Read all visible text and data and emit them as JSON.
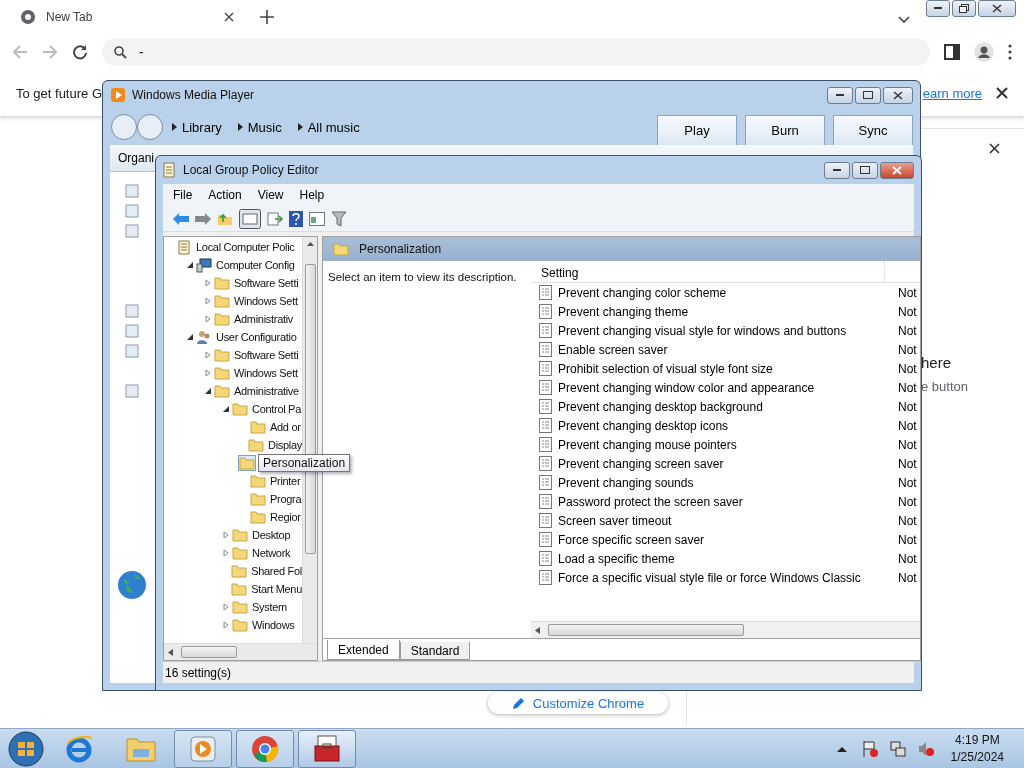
{
  "browser": {
    "tab_title": "New Tab",
    "address": "-",
    "infobar_text": "To get future G",
    "infobar_link": "earn more",
    "side_heading": "here",
    "side_text": "e button",
    "customize_button": "Customize Chrome"
  },
  "media_player": {
    "title": "Windows Media Player",
    "breadcrumb": [
      "Library",
      "Music",
      "All music"
    ],
    "tabs": [
      "Play",
      "Burn",
      "Sync"
    ],
    "organize": "Organi"
  },
  "policy_editor": {
    "title": "Local Group Policy Editor",
    "menu": [
      "File",
      "Action",
      "View",
      "Help"
    ],
    "tree": [
      {
        "label": "Local Computer Polic",
        "kind": "root",
        "children": [
          {
            "label": "Computer Config",
            "kind": "computer",
            "expanded": true,
            "children": [
              {
                "label": "Software Setti",
                "kind": "folder",
                "expanded": false
              },
              {
                "label": "Windows Sett",
                "kind": "folder",
                "expanded": false
              },
              {
                "label": "Administrativ",
                "kind": "folder",
                "expanded": false
              }
            ]
          },
          {
            "label": "User Configuratio",
            "kind": "user",
            "expanded": true,
            "children": [
              {
                "label": "Software Setti",
                "kind": "folder",
                "expanded": false
              },
              {
                "label": "Windows Sett",
                "kind": "folder",
                "expanded": false
              },
              {
                "label": "Administrative",
                "kind": "folder",
                "expanded": true,
                "children": [
                  {
                    "label": "Control Pa",
                    "kind": "folder",
                    "expanded": true,
                    "children": [
                      {
                        "label": "Add or",
                        "kind": "folder"
                      },
                      {
                        "label": "Display",
                        "kind": "folder"
                      },
                      {
                        "tooltip": "Personalization",
                        "kind": "folder",
                        "selected": true
                      },
                      {
                        "label": "Printer",
                        "kind": "folder"
                      },
                      {
                        "label": "Progra",
                        "kind": "folder"
                      },
                      {
                        "label": "Regior",
                        "kind": "folder"
                      }
                    ]
                  },
                  {
                    "label": "Desktop",
                    "kind": "folder",
                    "expanded": false
                  },
                  {
                    "label": "Network",
                    "kind": "folder",
                    "expanded": false
                  },
                  {
                    "label": "Shared Fol",
                    "kind": "folder"
                  },
                  {
                    "label": "Start Menu",
                    "kind": "folder"
                  },
                  {
                    "label": "System",
                    "kind": "folder",
                    "expanded": false
                  },
                  {
                    "label": "Windows",
                    "kind": "folder",
                    "expanded": false
                  }
                ]
              }
            ]
          }
        ]
      }
    ],
    "header": "Personalization",
    "description": "Select an item to view its description.",
    "column": "Setting",
    "rows": [
      {
        "name": "Prevent changing color scheme",
        "state": "Not"
      },
      {
        "name": "Prevent changing theme",
        "state": "Not"
      },
      {
        "name": "Prevent changing visual style for windows and buttons",
        "state": "Not"
      },
      {
        "name": "Enable screen saver",
        "state": "Not"
      },
      {
        "name": "Prohibit selection of visual style font size",
        "state": "Not"
      },
      {
        "name": "Prevent changing window color and appearance",
        "state": "Not"
      },
      {
        "name": "Prevent changing desktop background",
        "state": "Not"
      },
      {
        "name": "Prevent changing desktop icons",
        "state": "Not"
      },
      {
        "name": "Prevent changing mouse pointers",
        "state": "Not"
      },
      {
        "name": "Prevent changing screen saver",
        "state": "Not"
      },
      {
        "name": "Prevent changing sounds",
        "state": "Not"
      },
      {
        "name": "Password protect the screen saver",
        "state": "Not"
      },
      {
        "name": "Screen saver timeout",
        "state": "Not"
      },
      {
        "name": "Force specific screen saver",
        "state": "Not"
      },
      {
        "name": "Load a specific theme",
        "state": "Not"
      },
      {
        "name": "Force a specific visual style file or force Windows Classic",
        "state": "Not"
      }
    ],
    "tabs": [
      {
        "label": "Extended",
        "selected": true
      },
      {
        "label": "Standard",
        "selected": false
      }
    ],
    "status": "16 setting(s)"
  },
  "taskbar": {
    "apps": [
      {
        "kind": "ie",
        "open": false,
        "selected": false
      },
      {
        "kind": "explorer",
        "open": false,
        "selected": false
      },
      {
        "kind": "media",
        "open": true,
        "selected": false
      },
      {
        "kind": "chrome",
        "open": true,
        "selected": false
      },
      {
        "kind": "policy",
        "open": true,
        "selected": true
      }
    ],
    "time": "4:19 PM",
    "date": "1/25/2024"
  }
}
